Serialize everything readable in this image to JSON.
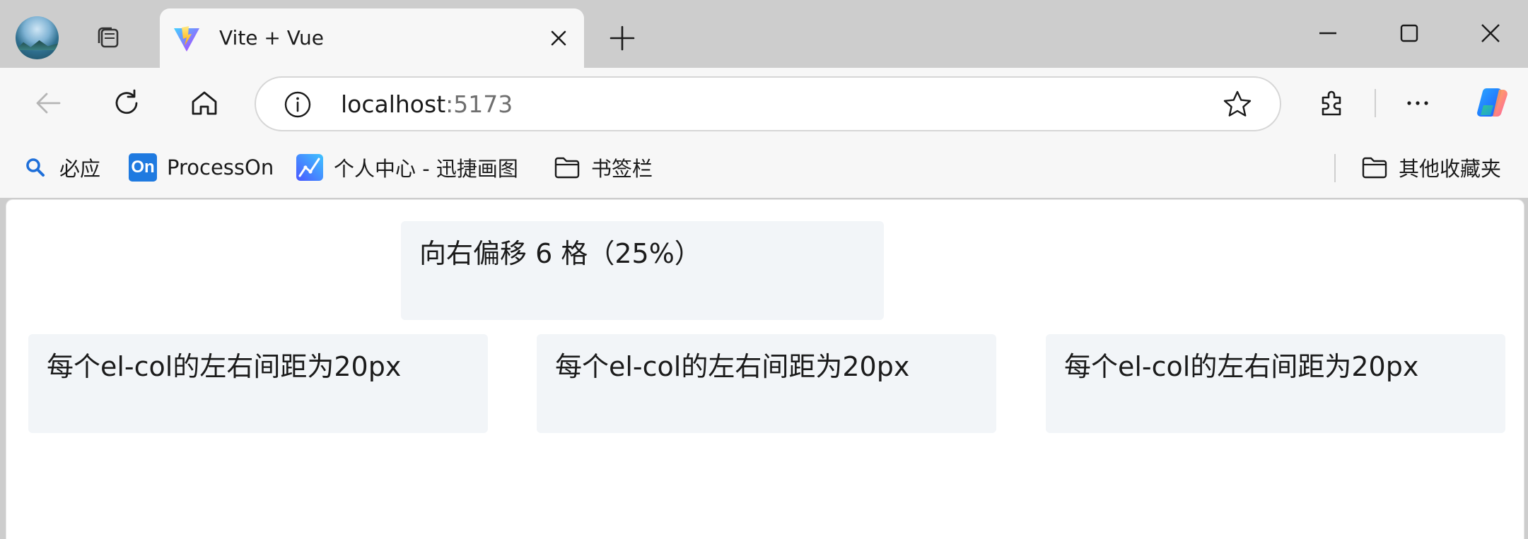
{
  "window": {
    "controls": {
      "minimize": "minimize-icon",
      "maximize": "maximize-icon",
      "close": "close-icon"
    }
  },
  "tabs": [
    {
      "title": "Vite + Vue",
      "favicon": "vite-icon",
      "active": true
    }
  ],
  "address_bar": {
    "host": "localhost",
    "port": ":5173"
  },
  "bookmarks": {
    "items": [
      {
        "label": "必应",
        "icon": "bing-search-icon"
      },
      {
        "label": "ProcessOn",
        "icon": "processon-icon",
        "icon_text": "On"
      },
      {
        "label": "个人中心 - 迅捷画图",
        "icon": "xunjie-icon"
      },
      {
        "label": "书签栏",
        "icon": "folder-icon"
      }
    ],
    "other": {
      "label": "其他收藏夹",
      "icon": "folder-icon"
    }
  },
  "page": {
    "offset_cell": "向右偏移 6 格（25%）",
    "gutter_cells": [
      "每个el-col的左右间距为20px",
      "每个el-col的左右间距为20px",
      "每个el-col的左右间距为20px"
    ]
  },
  "colors": {
    "cell_background": "#f2f5f8",
    "chrome_background": "#cdcdcd",
    "toolbar_background": "#f7f7f7"
  }
}
